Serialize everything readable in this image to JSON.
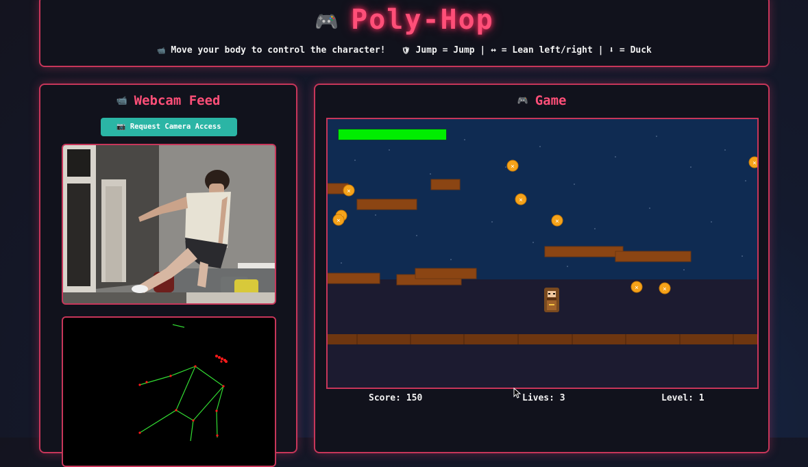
{
  "header": {
    "icon": "gamepad-icon",
    "title": "Poly-Hop",
    "subtitle_intro": "Move your body to control the character!",
    "controls": "Jump = Jump | ↔ = Lean left/right | ⬇ = Duck"
  },
  "webcam": {
    "title": "Webcam Feed",
    "icon": "video-camera-icon",
    "button_label": "Request Camera Access",
    "button_icon": "camera-icon"
  },
  "game": {
    "title": "Game",
    "icon": "gamepad-icon",
    "health": 1.0,
    "stats": {
      "score": "Score: 150",
      "lives": "Lives: 3",
      "level": "Level: 1"
    }
  },
  "colors": {
    "accent": "#ff4f78",
    "border": "#c8365a",
    "button": "#2bb5a5",
    "health": "#00ee00",
    "platform": "#8b4513",
    "sky": "#0f2b52",
    "skeleton": "#33dd33",
    "joint": "#ff1a1a"
  }
}
